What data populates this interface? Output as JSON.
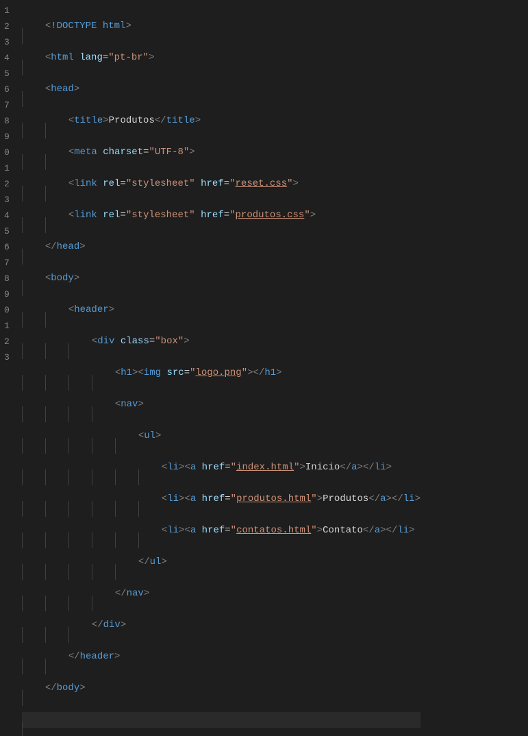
{
  "gutter": [
    "1",
    "2",
    "3",
    "4",
    "5",
    "6",
    "7",
    "8",
    "9",
    "0",
    "1",
    "2",
    "3",
    "4",
    "5",
    "6",
    "7",
    "8",
    "9",
    "0",
    "1",
    "2",
    "3"
  ],
  "t": {
    "lt": "<",
    "gt": ">",
    "lts": "</",
    "dt": "!DOCTYPE",
    "sp": " ",
    "q": "\"",
    "eq": "=",
    "html": "html",
    "htmlT": "html",
    "lang": "lang",
    "langV": "pt-br",
    "head": "head",
    "title": "title",
    "titleTxt": "Produtos",
    "meta": "meta",
    "charset": "charset",
    "charsetV": "UTF-8",
    "link": "link",
    "rel": "rel",
    "relV": "stylesheet",
    "href": "href",
    "reset": "reset.css",
    "produtosCss": "produtos.css",
    "body": "body",
    "header": "header",
    "div": "div",
    "class": "class",
    "box": "box",
    "h1": "h1",
    "img": "img",
    "src": "src",
    "logo": "logo.png",
    "nav": "nav",
    "ul": "ul",
    "li": "li",
    "a": "a",
    "idx": "index.html",
    "prod": "produtos.html",
    "cont": "contatos.html",
    "inicio": "Inicio",
    "produtos": "Produtos",
    "contato": "Contato"
  }
}
